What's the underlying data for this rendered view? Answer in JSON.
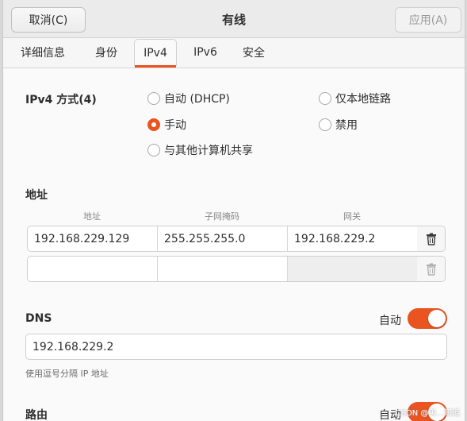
{
  "header": {
    "cancel_label": "取消(C)",
    "title": "有线",
    "apply_label": "应用(A)"
  },
  "tabs": [
    "详细信息",
    "身份",
    "IPv4",
    "IPv6",
    "安全"
  ],
  "ipv4_method": {
    "label": "IPv4 方式(4)",
    "options": [
      "自动 (DHCP)",
      "仅本地链路",
      "手动",
      "禁用",
      "与其他计算机共享"
    ],
    "selected": "手动"
  },
  "addresses": {
    "section_label": "地址",
    "columns": [
      "地址",
      "子网掩码",
      "网关"
    ],
    "rows": [
      {
        "address": "192.168.229.129",
        "netmask": "255.255.255.0",
        "gateway": "192.168.229.2"
      },
      {
        "address": "",
        "netmask": "",
        "gateway": ""
      }
    ]
  },
  "dns": {
    "label": "DNS",
    "auto_label": "自动",
    "auto_on": true,
    "value": "192.168.229.2",
    "hint": "使用逗号分隔 IP 地址"
  },
  "routes": {
    "label": "路由",
    "auto_label": "自动",
    "auto_on": true
  },
  "watermark": "CSDN @美...知道",
  "colors": {
    "accent": "#e95420"
  }
}
